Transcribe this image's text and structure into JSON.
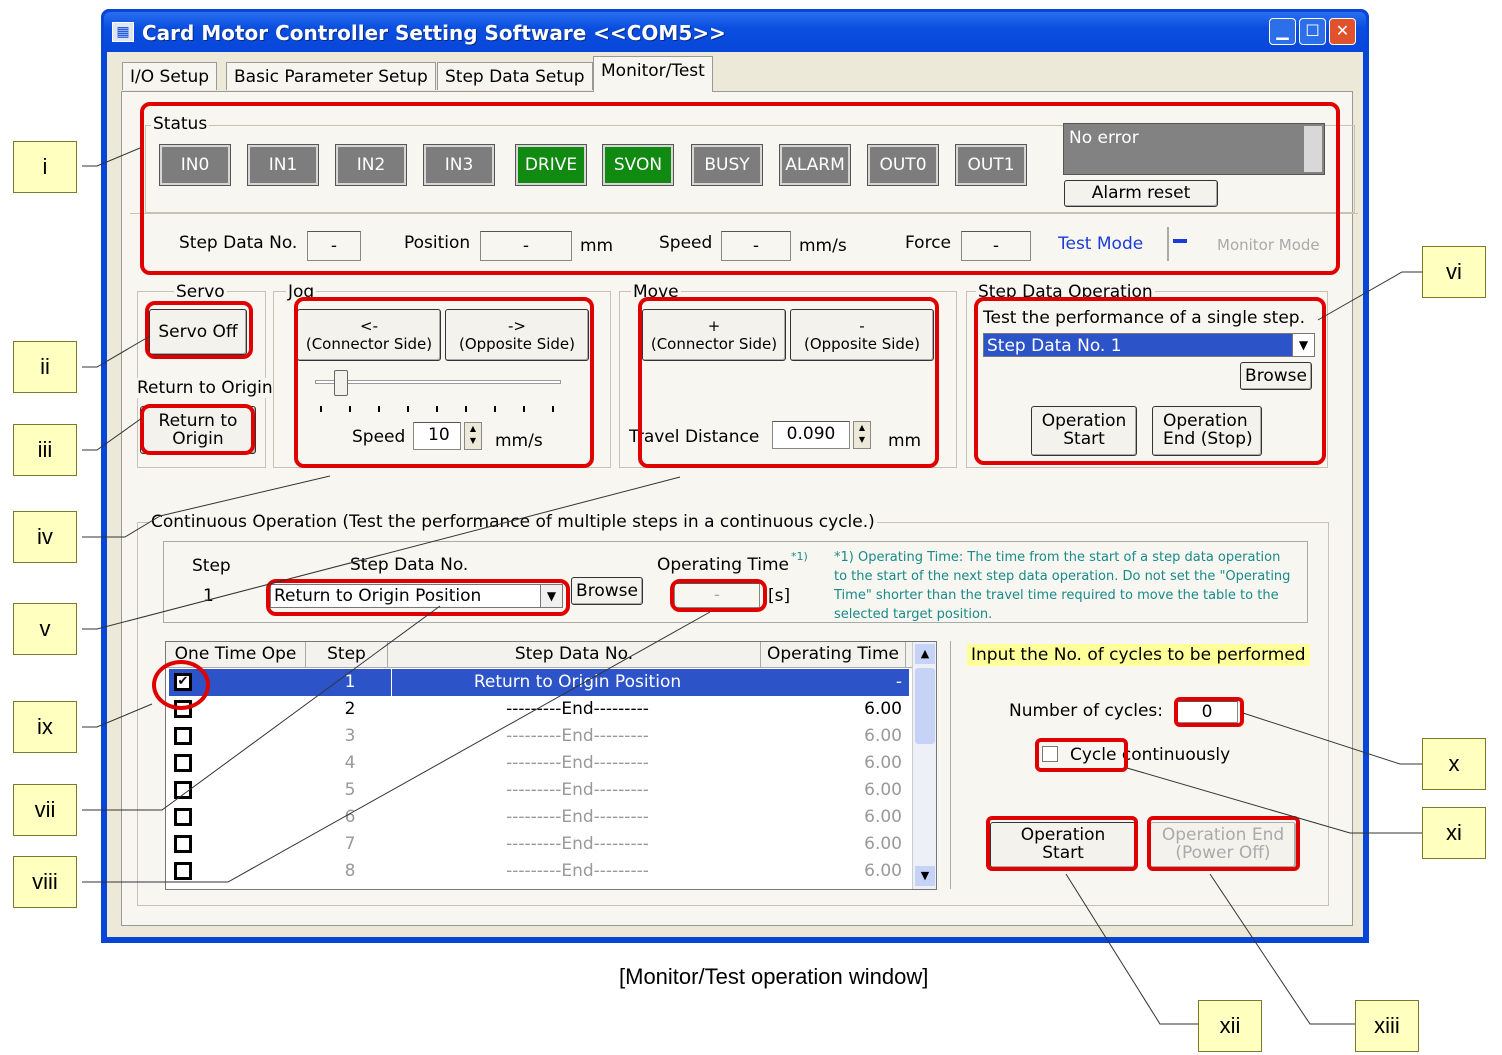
{
  "window": {
    "title": "Card Motor Controller Setting Software <<COM5>>"
  },
  "tabs": [
    "I/O Setup",
    "Basic Parameter Setup",
    "Step Data Setup",
    "Monitor/Test"
  ],
  "status": {
    "label": "Status",
    "leds": [
      {
        "label": "IN0",
        "on": false
      },
      {
        "label": "IN1",
        "on": false
      },
      {
        "label": "IN2",
        "on": false
      },
      {
        "label": "IN3",
        "on": false
      },
      {
        "label": "DRIVE",
        "on": true
      },
      {
        "label": "SVON",
        "on": true
      },
      {
        "label": "BUSY",
        "on": false
      },
      {
        "label": "ALARM",
        "on": false
      },
      {
        "label": "OUT0",
        "on": false
      },
      {
        "label": "OUT1",
        "on": false
      }
    ],
    "error_text": "No error",
    "alarm_reset": "Alarm reset",
    "step_label": "Step Data No.",
    "step_val": "-",
    "pos_label": "Position",
    "pos_val": "-",
    "pos_unit": "mm",
    "speed_label": "Speed",
    "speed_val": "-",
    "speed_unit": "mm/s",
    "force_label": "Force",
    "force_val": "-",
    "test_mode": "Test Mode",
    "monitor_mode": "Monitor Mode"
  },
  "servo": {
    "label": "Servo",
    "button": "Servo Off",
    "rto_label": "Return to Origin",
    "rto_btn1": "Return to",
    "rto_btn2": "Origin"
  },
  "jog": {
    "label": "Jog",
    "left_arrow": "<-",
    "left": "(Connector Side)",
    "right_arrow": "->",
    "right": "(Opposite Side)",
    "speed_label": "Speed",
    "speed_val": "10",
    "unit": "mm/s"
  },
  "move": {
    "label": "Move",
    "plus": "+",
    "plus_side": "(Connector Side)",
    "minus": "-",
    "minus_side": "(Opposite Side)",
    "dist_label": "Travel Distance",
    "dist_val": "0.090",
    "unit": "mm"
  },
  "step_op": {
    "label": "Step Data Operation",
    "desc": "Test the performance of a single step.",
    "select": "Step Data No. 1",
    "browse": "Browse",
    "start1": "Operation",
    "start2": "Start",
    "end1": "Operation",
    "end2": "End (Stop)"
  },
  "cont": {
    "label": "Continuous Operation (Test the performance of multiple steps in a continuous cycle.)",
    "step_h": "Step",
    "step_v": "1",
    "sdn_h": "Step Data No.",
    "sdn_val": "Return to Origin Position",
    "browse": "Browse",
    "optime_h": "Operating Time",
    "optime_sup": "*1)",
    "optime_val": "-",
    "optime_unit": "[s]",
    "note": "*1) Operating Time: The time from the start of a step data operation to the start of the next step data operation. Do not set the \"Operating Time\" shorter than the travel time required to move the table to the selected target position.",
    "table_headers": [
      "One Time Ope",
      "Step",
      "Step Data No.",
      "Operating Time"
    ],
    "rows": [
      {
        "checked": true,
        "step": "1",
        "sdn": "Return to Origin Position",
        "time": "-"
      },
      {
        "checked": false,
        "step": "2",
        "sdn": "---------End---------",
        "time": "6.00"
      },
      {
        "checked": false,
        "step": "3",
        "sdn": "---------End---------",
        "time": "6.00"
      },
      {
        "checked": false,
        "step": "4",
        "sdn": "---------End---------",
        "time": "6.00"
      },
      {
        "checked": false,
        "step": "5",
        "sdn": "---------End---------",
        "time": "6.00"
      },
      {
        "checked": false,
        "step": "6",
        "sdn": "---------End---------",
        "time": "6.00"
      },
      {
        "checked": false,
        "step": "7",
        "sdn": "---------End---------",
        "time": "6.00"
      },
      {
        "checked": false,
        "step": "8",
        "sdn": "---------End---------",
        "time": "6.00"
      }
    ],
    "cycles_hint": "Input the No. of cycles to be performed",
    "cycles_label": "Number of cycles:",
    "cycles_val": "0",
    "cycle_cont": "Cycle continuously",
    "op_start1": "Operation",
    "op_start2": "Start",
    "op_end1": "Operation End",
    "op_end2": "(Power Off)"
  },
  "callouts": [
    "i",
    "ii",
    "iii",
    "iv",
    "v",
    "vi",
    "vii",
    "viii",
    "ix",
    "x",
    "xi",
    "xii",
    "xiii"
  ],
  "caption": "[Monitor/Test operation window]"
}
